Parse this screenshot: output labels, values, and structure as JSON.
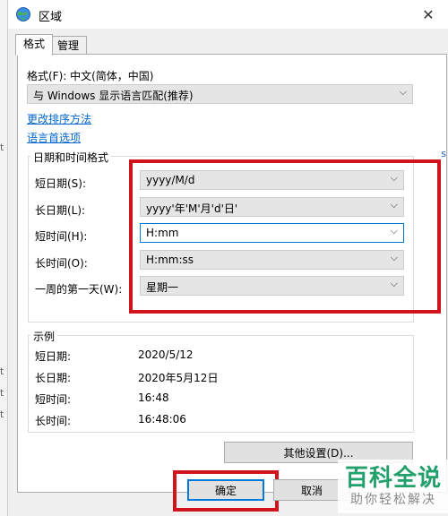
{
  "window": {
    "title": "区域",
    "close_glyph": "✕"
  },
  "tabs": [
    {
      "label": "格式",
      "active": true
    },
    {
      "label": "管理",
      "active": false
    }
  ],
  "format": {
    "label": "格式(F): 中文(简体，中国)",
    "value": "与 Windows 显示语言匹配(推荐)"
  },
  "links": {
    "sort": "更改排序方法",
    "lang": "语言首选项"
  },
  "datetime": {
    "group_title": "日期和时间格式",
    "rows": [
      {
        "label": "短日期(S):",
        "value": "yyyy/M/d"
      },
      {
        "label": "长日期(L):",
        "value": "yyyy'年'M'月'd'日'"
      },
      {
        "label": "短时间(H):",
        "value": "H:mm"
      },
      {
        "label": "长时间(O):",
        "value": "H:mm:ss"
      },
      {
        "label": "一周的第一天(W):",
        "value": "星期一"
      }
    ]
  },
  "examples": {
    "group_title": "示例",
    "rows": [
      {
        "label": "短日期:",
        "value": "2020/5/12"
      },
      {
        "label": "长日期:",
        "value": "2020年5月12日"
      },
      {
        "label": "短时间:",
        "value": "16:48"
      },
      {
        "label": "长时间:",
        "value": "16:48:06"
      }
    ]
  },
  "buttons": {
    "other_settings": "其他设置(D)...",
    "ok": "确定",
    "cancel": "取消"
  },
  "chevron_glyph": "⌵",
  "watermark": {
    "main": "百科全说",
    "sub": "助你轻松解决"
  },
  "background_fragments": {
    "left": [
      "t",
      "t",
      "t",
      "t"
    ],
    "right": "s"
  },
  "colors": {
    "highlight_red": "#d1141b",
    "link_blue": "#0066cc",
    "focus_blue": "#0078d7",
    "watermark_green": "#22a06b"
  }
}
